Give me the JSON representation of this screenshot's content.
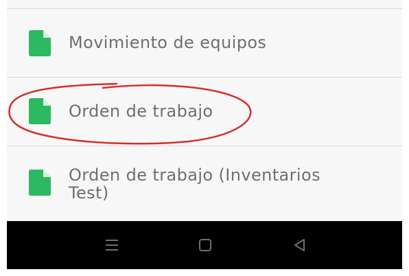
{
  "menu": {
    "items": [
      {
        "label": "Movimiento de equipos",
        "icon": "document-icon"
      },
      {
        "label": "Orden de trabajo",
        "icon": "document-icon"
      },
      {
        "label": "Orden de trabajo (Inventarios",
        "label_line2": "Test)",
        "icon": "document-icon"
      }
    ]
  },
  "navigation_bar": {
    "buttons": [
      {
        "icon": "menu-lines-icon"
      },
      {
        "icon": "home-square-icon"
      },
      {
        "icon": "back-triangle-icon"
      }
    ]
  },
  "colors": {
    "icon_green": "#2db862",
    "text_gray": "#6f6f6f",
    "list_background": "#f7f7f7",
    "divider": "#d8d8d8",
    "nav_background": "#000000",
    "nav_icon": "#6f6f6f",
    "annotation_red": "#d82c2c"
  }
}
